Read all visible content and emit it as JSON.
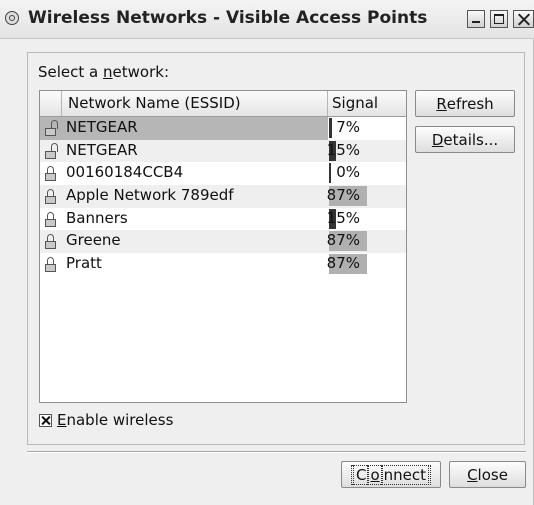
{
  "window": {
    "title": "Wireless Networks - Visible Access Points"
  },
  "selector": {
    "label_prefix": "Select a ",
    "label_accel": "n",
    "label_suffix": "etwork:"
  },
  "table": {
    "columns": [
      "",
      "Network Name (ESSID)",
      "Signal"
    ],
    "rows": [
      {
        "name": "NETGEAR",
        "signal": "7%",
        "signal_fraction": 0.07,
        "locked": false,
        "selected": true
      },
      {
        "name": "NETGEAR",
        "signal": "15%",
        "signal_fraction": 0.15,
        "locked": false,
        "selected": false
      },
      {
        "name": "00160184CCB4",
        "signal": "0%",
        "signal_fraction": 0.0,
        "locked": true,
        "selected": false
      },
      {
        "name": "Apple Network 789edf",
        "signal": "87%",
        "signal_fraction": 0.87,
        "locked": true,
        "selected": false
      },
      {
        "name": "Banners",
        "signal": "15%",
        "signal_fraction": 0.15,
        "locked": true,
        "selected": false
      },
      {
        "name": "Greene",
        "signal": "87%",
        "signal_fraction": 0.87,
        "locked": true,
        "selected": false
      },
      {
        "name": "Pratt",
        "signal": "87%",
        "signal_fraction": 0.87,
        "locked": true,
        "selected": false
      }
    ]
  },
  "buttons": {
    "refresh_accel": "R",
    "refresh_rest": "efresh",
    "details_accel": "D",
    "details_rest": "etails...",
    "connect_pre": "C",
    "connect_accel": "o",
    "connect_rest": "nnect",
    "close_accel": "C",
    "close_rest": "lose"
  },
  "enable_wireless": {
    "accel": "E",
    "rest": "nable wireless",
    "checked": true
  },
  "colors": {
    "strong_signal": "#b0b0b0",
    "weak_signal": "#333333",
    "selected_row": "#b6b6b6"
  }
}
